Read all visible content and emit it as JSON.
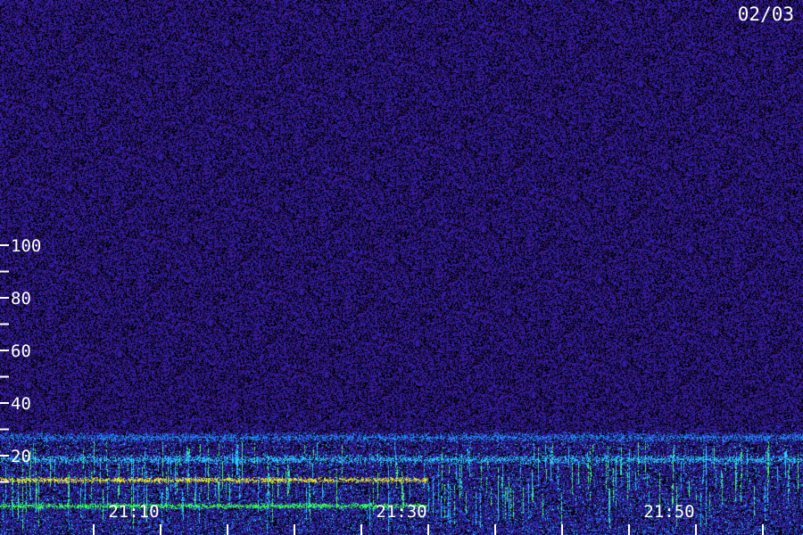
{
  "date_label": "02/03",
  "chart_data": {
    "type": "heatmap",
    "title": "",
    "xlabel": "",
    "ylabel": "",
    "y_ticks": [
      "100",
      "80",
      "60",
      "40",
      "20"
    ],
    "x_ticks": [
      "21:10",
      "21:30",
      "21:50"
    ],
    "y_range": [
      0,
      109
    ],
    "x_range_minutes": [
      "21:07",
      "21:57"
    ],
    "grid": false,
    "colormap": [
      "#000000",
      "#24104f",
      "#3a1fa8",
      "#1e6cff",
      "#28d9ff",
      "#50ff50"
    ],
    "features": [
      {
        "y_value": 27,
        "intensity": "medium",
        "color": "#1e8cff"
      },
      {
        "y_value": 18.5,
        "intensity": "medium",
        "color": "#28c8ff"
      },
      {
        "y_value": 11,
        "intensity": "high",
        "color": "#e6e632"
      },
      {
        "y_value": 1,
        "intensity": "high",
        "color": "#32ff50"
      }
    ]
  }
}
